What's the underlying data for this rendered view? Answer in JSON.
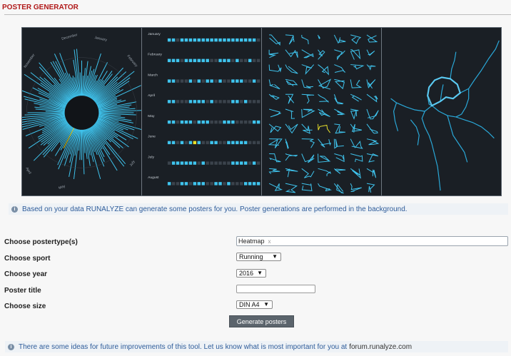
{
  "header": {
    "title": "POSTER GENERATOR"
  },
  "preview": {
    "posters": [
      {
        "type": "circular",
        "months": [
          "December",
          "January",
          "February",
          "November",
          "April",
          "May",
          "July"
        ]
      },
      {
        "type": "calendar",
        "months": [
          "January",
          "February",
          "March",
          "April",
          "May",
          "June",
          "July",
          "August"
        ]
      },
      {
        "type": "grid"
      },
      {
        "type": "heatmap"
      }
    ]
  },
  "info_top": {
    "text": "Based on your data RUNALYZE can generate some posters for you. Poster generations are performed in the background."
  },
  "form": {
    "postertype": {
      "label": "Choose postertype(s)",
      "tag": "Heatmap",
      "remove": "x"
    },
    "sport": {
      "label": "Choose sport",
      "value": "Running"
    },
    "year": {
      "label": "Choose year",
      "value": "2016"
    },
    "title": {
      "label": "Poster title",
      "value": ""
    },
    "size": {
      "label": "Choose size",
      "value": "DIN A4"
    },
    "submit": "Generate posters"
  },
  "info_bottom": {
    "text": "There are some ideas for future improvements of this tool. Let us know what is most important for you at",
    "link": "forum.runalyze.com"
  },
  "colors": {
    "accent": "#b01818",
    "track": "#3fc4ee",
    "highlight": "#e8e02a",
    "poster_bg": "#1a1f25"
  },
  "icons": {
    "arrow": "▼",
    "info": "i"
  }
}
